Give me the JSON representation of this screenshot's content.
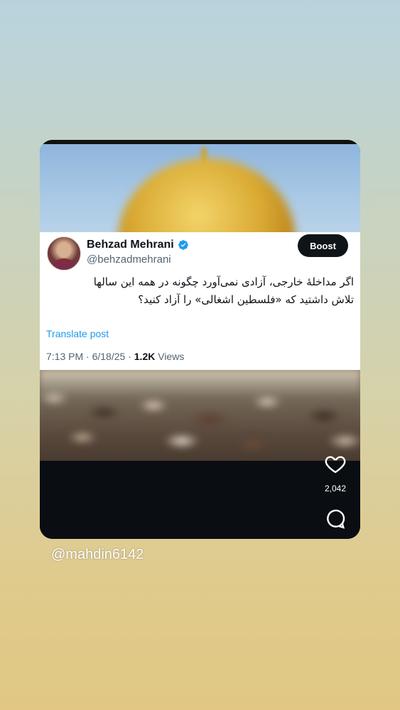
{
  "tweet": {
    "display_name": "Behzad Mehrani",
    "handle": "@behzadmehrani",
    "boost_label": "Boost",
    "text_line1": "اگر مداخلهٔ خارجی، آزادی نمی‌آورد چگونه در همه این سالها",
    "text_line2": "تلاش داشتید که «فلسطین اشغالی» را آزاد کنید؟",
    "translate_label": "Translate post",
    "time": "7:13 PM",
    "date": "6/18/25",
    "views_count": "1.2K",
    "views_label": "Views",
    "verified_icon": "verified-badge-icon"
  },
  "story": {
    "like_count": "2,042",
    "like_icon": "heart-icon",
    "comment_icon": "comment-icon",
    "credit": "@mahdin6142"
  },
  "colors": {
    "accent_blue": "#1d9bf0",
    "text_primary": "#0f1419",
    "text_secondary": "#536471",
    "button_dark": "#0f1419"
  }
}
